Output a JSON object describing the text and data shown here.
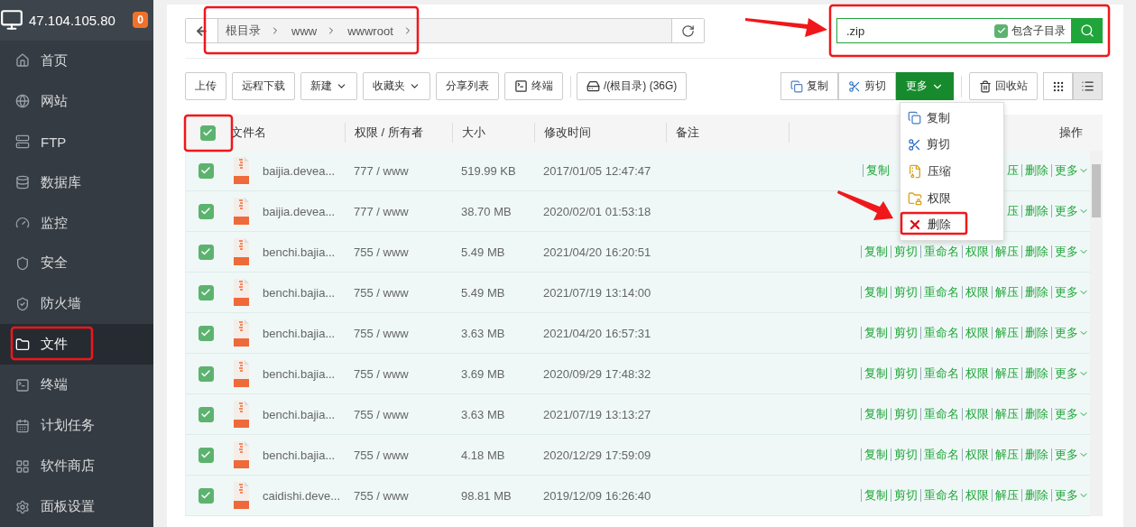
{
  "sidebar": {
    "host": "47.104.105.80",
    "badge": "0",
    "items": [
      {
        "label": "首页",
        "selected": false
      },
      {
        "label": "网站",
        "selected": false
      },
      {
        "label": "FTP",
        "selected": false
      },
      {
        "label": "数据库",
        "selected": false
      },
      {
        "label": "监控",
        "selected": false
      },
      {
        "label": "安全",
        "selected": false
      },
      {
        "label": "防火墙",
        "selected": false
      },
      {
        "label": "文件",
        "selected": true
      },
      {
        "label": "终端",
        "selected": false
      },
      {
        "label": "计划任务",
        "selected": false
      },
      {
        "label": "软件商店",
        "selected": false
      },
      {
        "label": "面板设置",
        "selected": false
      }
    ]
  },
  "breadcrumb": {
    "segments": [
      "根目录",
      "www",
      "wwwroot"
    ]
  },
  "search": {
    "value": ".zip",
    "include_subdirs": {
      "label": "包含子目录",
      "checked": true
    }
  },
  "toolbar": {
    "left": [
      {
        "label": "上传",
        "kind": "plain"
      },
      {
        "label": "远程下载",
        "kind": "plain"
      },
      {
        "label": "新建",
        "kind": "dropdown"
      },
      {
        "label": "收藏夹",
        "kind": "dropdown"
      },
      {
        "label": "分享列表",
        "kind": "plain"
      },
      {
        "label": "终端",
        "kind": "terminal"
      },
      {
        "label": "/(根目录) (36G)",
        "kind": "disk"
      }
    ],
    "clipboard": [
      "复制",
      "剪切"
    ],
    "more": {
      "label": "更多",
      "expanded": true
    },
    "recycle": "回收站",
    "views": [
      {
        "selected": false
      },
      {
        "selected": true
      }
    ]
  },
  "more_menu": [
    "复制",
    "剪切",
    "压缩",
    "权限",
    "删除"
  ],
  "table": {
    "all_checked": true,
    "columns": [
      "文件名",
      "权限 / 所有者",
      "大小",
      "修改时间",
      "备注",
      "操作"
    ],
    "rows": [
      {
        "checked": true,
        "name": "baijia.devea...",
        "perm": "777 / www",
        "size": "519.99 KB",
        "time": "2017/01/05 12:47:47",
        "actions": [
          {
            "kind": "link",
            "label": "复制"
          },
          {
            "kind": "covered"
          },
          {
            "kind": "link",
            "label": "压"
          },
          {
            "kind": "link",
            "label": "删除"
          },
          {
            "kind": "menu",
            "label": "更多"
          }
        ]
      },
      {
        "checked": true,
        "name": "baijia.devea...",
        "perm": "777 / www",
        "size": "38.70 MB",
        "time": "2020/02/01 01:53:18",
        "actions": [
          {
            "kind": "covered"
          },
          {
            "kind": "link",
            "label": "压"
          },
          {
            "kind": "link",
            "label": "删除"
          },
          {
            "kind": "menu",
            "label": "更多"
          }
        ]
      },
      {
        "checked": true,
        "name": "benchi.bajia...",
        "perm": "755 / www",
        "size": "5.49 MB",
        "time": "2021/04/20 16:20:51",
        "actions": [
          {
            "kind": "link",
            "label": "复制"
          },
          {
            "kind": "link",
            "label": "剪切"
          },
          {
            "kind": "link",
            "label": "重命名"
          },
          {
            "kind": "link",
            "label": "权限"
          },
          {
            "kind": "link",
            "label": "解压"
          },
          {
            "kind": "link",
            "label": "删除"
          },
          {
            "kind": "menu",
            "label": "更多"
          }
        ]
      },
      {
        "checked": true,
        "name": "benchi.bajia...",
        "perm": "755 / www",
        "size": "5.49 MB",
        "time": "2021/07/19 13:14:00",
        "actions": [
          {
            "kind": "link",
            "label": "复制"
          },
          {
            "kind": "link",
            "label": "剪切"
          },
          {
            "kind": "link",
            "label": "重命名"
          },
          {
            "kind": "link",
            "label": "权限"
          },
          {
            "kind": "link",
            "label": "解压"
          },
          {
            "kind": "link",
            "label": "删除"
          },
          {
            "kind": "menu",
            "label": "更多"
          }
        ]
      },
      {
        "checked": true,
        "name": "benchi.bajia...",
        "perm": "755 / www",
        "size": "3.63 MB",
        "time": "2021/04/20 16:57:31",
        "actions": [
          {
            "kind": "link",
            "label": "复制"
          },
          {
            "kind": "link",
            "label": "剪切"
          },
          {
            "kind": "link",
            "label": "重命名"
          },
          {
            "kind": "link",
            "label": "权限"
          },
          {
            "kind": "link",
            "label": "解压"
          },
          {
            "kind": "link",
            "label": "删除"
          },
          {
            "kind": "menu",
            "label": "更多"
          }
        ]
      },
      {
        "checked": true,
        "name": "benchi.bajia...",
        "perm": "755 / www",
        "size": "3.69 MB",
        "time": "2020/09/29 17:48:32",
        "actions": [
          {
            "kind": "link",
            "label": "复制"
          },
          {
            "kind": "link",
            "label": "剪切"
          },
          {
            "kind": "link",
            "label": "重命名"
          },
          {
            "kind": "link",
            "label": "权限"
          },
          {
            "kind": "link",
            "label": "解压"
          },
          {
            "kind": "link",
            "label": "删除"
          },
          {
            "kind": "menu",
            "label": "更多"
          }
        ]
      },
      {
        "checked": true,
        "name": "benchi.bajia...",
        "perm": "755 / www",
        "size": "3.63 MB",
        "time": "2021/07/19 13:13:27",
        "actions": [
          {
            "kind": "link",
            "label": "复制"
          },
          {
            "kind": "link",
            "label": "剪切"
          },
          {
            "kind": "link",
            "label": "重命名"
          },
          {
            "kind": "link",
            "label": "权限"
          },
          {
            "kind": "link",
            "label": "解压"
          },
          {
            "kind": "link",
            "label": "删除"
          },
          {
            "kind": "menu",
            "label": "更多"
          }
        ]
      },
      {
        "checked": true,
        "name": "benchi.bajia...",
        "perm": "755 / www",
        "size": "4.18 MB",
        "time": "2020/12/29 17:59:09",
        "actions": [
          {
            "kind": "link",
            "label": "复制"
          },
          {
            "kind": "link",
            "label": "剪切"
          },
          {
            "kind": "link",
            "label": "重命名"
          },
          {
            "kind": "link",
            "label": "权限"
          },
          {
            "kind": "link",
            "label": "解压"
          },
          {
            "kind": "link",
            "label": "删除"
          },
          {
            "kind": "menu",
            "label": "更多"
          }
        ]
      },
      {
        "checked": true,
        "name": "caidishi.deve...",
        "perm": "755 / www",
        "size": "98.81 MB",
        "time": "2019/12/09 16:26:40",
        "actions": [
          {
            "kind": "link",
            "label": "复制"
          },
          {
            "kind": "link",
            "label": "剪切"
          },
          {
            "kind": "link",
            "label": "重命名"
          },
          {
            "kind": "link",
            "label": "权限"
          },
          {
            "kind": "link",
            "label": "解压"
          },
          {
            "kind": "link",
            "label": "删除"
          },
          {
            "kind": "menu",
            "label": "更多"
          }
        ]
      }
    ]
  }
}
